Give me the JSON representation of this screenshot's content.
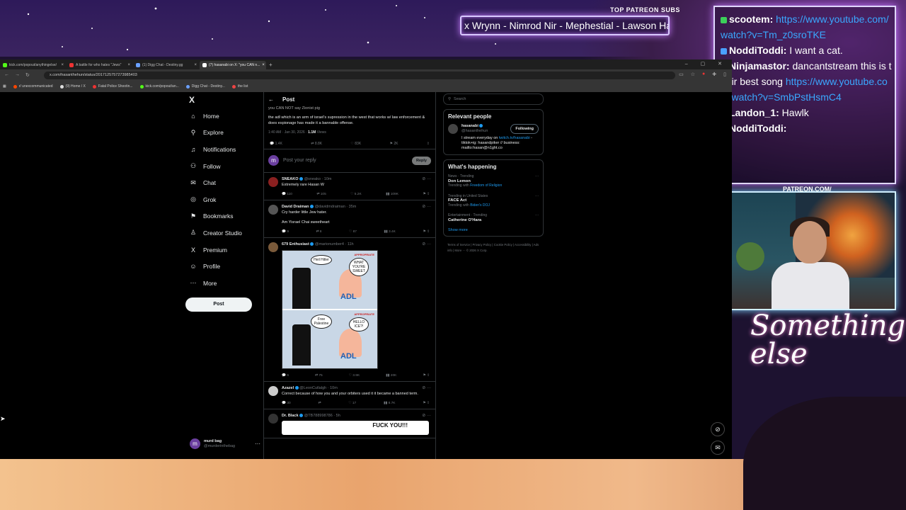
{
  "overlay": {
    "patreon_label": "TOP PATREON SUBS",
    "marquee_text": "x Wrynn - Nimrod Nir - Mephestial - Lawson Ha",
    "patreon_url": "PATREON.COM/",
    "brand_text": "Something else",
    "chat": [
      {
        "user": "scootem:",
        "text": "",
        "url": "https://www.youtube.com/watch?v=Tm_z0sroTKE",
        "chip": "#3ccf5a"
      },
      {
        "user": "NoddiToddi:",
        "text": " I want a cat.",
        "url": "",
        "chip": "#4aa0ff"
      },
      {
        "user": "Ninjamastor:",
        "text": " dancantstream this is their best song",
        "url": "https://www.youtube.com/watch?v=SmbPstHsmC4",
        "chip": "#4aa0ff"
      },
      {
        "user": "Landon_1:",
        "text": " Hawlk",
        "url": "",
        "chip": "#4aa0ff"
      },
      {
        "user": "NoddiToddi:",
        "text": "",
        "url": "",
        "chip": "#4aa0ff"
      }
    ]
  },
  "browser": {
    "tabs": [
      {
        "label": "kick.com/popout/anythingelse/",
        "color": "#53fc18"
      },
      {
        "label": "A battle for who hates \"Jews\"",
        "color": "#e33"
      },
      {
        "label": "(1) Digg Chat - Destiny.gg",
        "color": "#6aa0ff"
      },
      {
        "label": "(7) hasanabi on X: \"you CAN n...",
        "color": "#fff"
      }
    ],
    "url": "x.com/hasanthehun/status/2017125757273985403",
    "bookmarks": [
      {
        "label": "r/ unexcommunicated",
        "color": "#ff4500"
      },
      {
        "label": "(9) Home / X",
        "color": "#ddd"
      },
      {
        "label": "Fatal Police Shootin...",
        "color": "#e33"
      },
      {
        "label": "kick.com/popout/an...",
        "color": "#53fc18"
      },
      {
        "label": "Digg Chat - Destiny...",
        "color": "#6aa0ff"
      },
      {
        "label": "the list",
        "color": "#e44"
      }
    ]
  },
  "x": {
    "nav": [
      {
        "label": "Home",
        "icon": "⌂",
        "name": "home"
      },
      {
        "label": "Explore",
        "icon": "⚲",
        "name": "explore"
      },
      {
        "label": "Notifications",
        "icon": "♫",
        "name": "notifications"
      },
      {
        "label": "Follow",
        "icon": "⚇",
        "name": "follow"
      },
      {
        "label": "Chat",
        "icon": "✉",
        "name": "chat"
      },
      {
        "label": "Grok",
        "icon": "◎",
        "name": "grok"
      },
      {
        "label": "Bookmarks",
        "icon": "⚑",
        "name": "bookmarks"
      },
      {
        "label": "Creator Studio",
        "icon": "♙",
        "name": "creator-studio"
      },
      {
        "label": "Premium",
        "icon": "X",
        "name": "premium"
      },
      {
        "label": "Profile",
        "icon": "☺",
        "name": "profile"
      },
      {
        "label": "More",
        "icon": "⋯",
        "name": "more"
      }
    ],
    "post_button": "Post",
    "account": {
      "initial": "m",
      "name": "murd bag",
      "handle": "@murderinthebag"
    },
    "header_title": "Post",
    "main_post": {
      "cut_text": "you CAN NOT say Zionist pig",
      "text": "the adl which is an arm of israel's supression in the west that works w/ law enforcement & does espionage has made it a bannable offense.",
      "time": "1:40 AM · Jan 30, 2026 · ",
      "views": "1.1M",
      "views_label": " Views",
      "stats": [
        "1.4K",
        "8.8K",
        "83K",
        "2K"
      ]
    },
    "reply_placeholder": "Post your reply",
    "reply_button": "Reply",
    "reply_initial": "m",
    "replies": [
      {
        "name": "SNEAKO",
        "handle": "@sneako · 10m",
        "text": "Extremely rare Hasan W",
        "stats": [
          "110",
          "105",
          "5.2K",
          "109K"
        ],
        "avatar": "#8a2020"
      },
      {
        "name": "David Draiman",
        "handle": "@davidmdraiman · 35m",
        "text": "Cry harder little Jew hater.\n\nAm Yisrael Chai sweetheart",
        "stats": [
          "9",
          "8",
          "87",
          "3.4K"
        ],
        "avatar": "#555"
      },
      {
        "name": "679 Enthusiast",
        "handle": "@marionumber4 · 11h",
        "text": "",
        "stats": [
          "6",
          "75",
          "3.9K",
          "20K"
        ],
        "avatar": "#7a5a3a"
      },
      {
        "name": "Azazel",
        "handle": "@LeonCutlalgh · 10m",
        "text": "Correct because of how you and your orbiters used it it became a banned term.",
        "stats": [
          "30",
          "",
          "17",
          "8.7K"
        ],
        "avatar": "#ccc"
      },
      {
        "name": "Dr. Black",
        "handle": "@TB788998786 · 5h",
        "text": "",
        "stats": [],
        "avatar": "#333"
      }
    ],
    "comic": {
      "top_bubble_1": "Heil Hitler",
      "top_bubble_2": "WHAT YOU'RE SWEET",
      "bottom_bubble_1": "Free Palestine",
      "bottom_bubble_2": "HELLO ICE?!",
      "logo": "ADL",
      "tag": "APPROPRIATE"
    },
    "drblack_image_text": "FUCK YOU!!!",
    "search_placeholder": "Search",
    "relevant": {
      "title": "Relevant people",
      "name": "hasanabi",
      "handle": "@hasanthehun",
      "follow_label": "Following",
      "bio_1": "I stream everyday on ",
      "bio_link": "twitch.tv/hasanabi",
      "bio_2": " - tiktok+ig: hasandpiker // business: mailto:hasan@n1ght.co"
    },
    "happening": {
      "title": "What's happening",
      "trends": [
        {
          "context": "News · Trending",
          "name": "Don Lemon",
          "with": "Trending with ",
          "link": "Freedom of Religion"
        },
        {
          "context": "Trending in United States",
          "name": "FACE Act",
          "with": "Trending with ",
          "link": "Biden's DOJ"
        },
        {
          "context": "Entertainment · Trending",
          "name": "Catherine O'Hara",
          "with": "",
          "link": ""
        }
      ],
      "show_more": "Show more"
    },
    "footer": "Terms of Service  |  Privacy Policy  |  Cookie Policy  |  Accessibility  |  Ads info  |  More ···  © 2026 X Corp."
  }
}
